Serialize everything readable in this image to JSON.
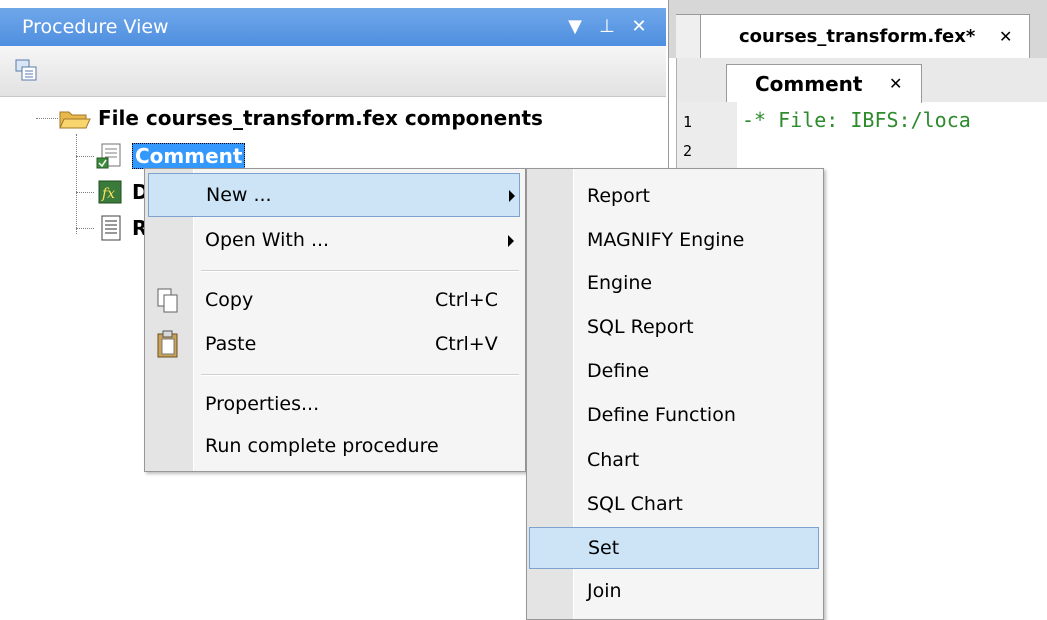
{
  "procedure_view": {
    "title": "Procedure View",
    "dropdown_glyph": "▼",
    "pin_glyph": "⊥",
    "close_glyph": "✕",
    "tree": {
      "root_label": "File courses_transform.fex components",
      "comment_label": "Comment",
      "hidden_item_1_char": "D",
      "hidden_item_2_char": "R"
    }
  },
  "editor": {
    "file_tab": {
      "label": "courses_transform.fex*",
      "close": "✕"
    },
    "comment_tab": {
      "label": "Comment",
      "close": "✕"
    },
    "line_numbers": [
      "1",
      "2"
    ],
    "code_line_1": "-* File: IBFS:/loca"
  },
  "context_menu": {
    "new_label": "New ...",
    "open_with_label": "Open With ...",
    "copy_label": "Copy",
    "copy_shortcut": "Ctrl+C",
    "paste_label": "Paste",
    "paste_shortcut": "Ctrl+V",
    "properties_label": "Properties...",
    "run_label": "Run complete procedure"
  },
  "new_submenu": {
    "items": [
      "Report",
      "MAGNIFY Engine",
      "Engine",
      "SQL Report",
      "Define",
      "Define Function",
      "Chart",
      "SQL Chart",
      "Set",
      "Join"
    ],
    "highlighted": "Set"
  },
  "colors": {
    "title_bar": "#4f8fe0",
    "selection": "#3399ff",
    "menu_highlight": "#cde4f7",
    "code_comment": "#2e8b2e"
  }
}
